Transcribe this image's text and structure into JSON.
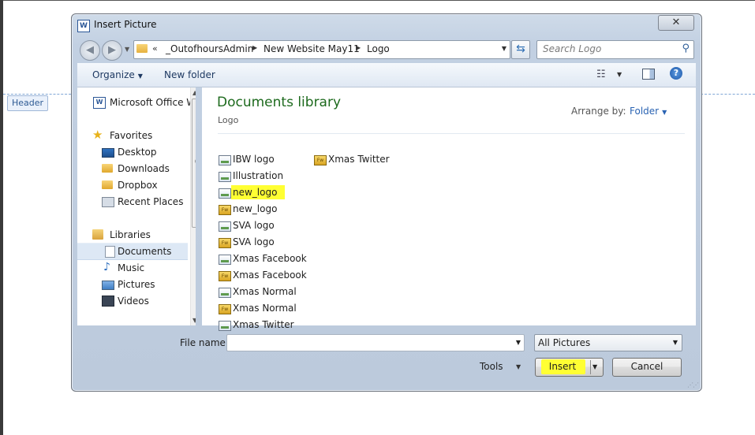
{
  "background": {
    "header_tag": "Header"
  },
  "dialog": {
    "title": "Insert Picture",
    "title_icon_glyph": "W",
    "close_glyph": "✕",
    "colors": {
      "library_title": "#1d6a1d",
      "link_blue": "#2a63b3",
      "highlight": "#ffff33"
    }
  },
  "address": {
    "overflow_glyph": "«",
    "crumbs": [
      "_OutofhoursAdmin",
      "New Website May11",
      "Logo"
    ]
  },
  "search": {
    "placeholder": "Search Logo"
  },
  "toolbar": {
    "organize_label": "Organize",
    "new_folder_label": "New folder"
  },
  "nav": {
    "computer_item": "Microsoft Office W",
    "favorites_header": "Favorites",
    "favorites": [
      "Desktop",
      "Downloads",
      "Dropbox",
      "Recent Places"
    ],
    "libraries_header": "Libraries",
    "libraries": [
      "Documents",
      "Music",
      "Pictures",
      "Videos"
    ],
    "selected": "Documents"
  },
  "content": {
    "library_title": "Documents library",
    "library_subtitle": "Logo",
    "arrange_label": "Arrange by:",
    "arrange_value": "Folder",
    "files": [
      {
        "name": "IBW logo",
        "icon": "image-file-icon",
        "highlighted": false
      },
      {
        "name": "Illustration",
        "icon": "image-file-icon",
        "highlighted": false
      },
      {
        "name": "new_logo",
        "icon": "image-file-icon",
        "highlighted": true
      },
      {
        "name": "new_logo",
        "icon": "fireworks-file-icon",
        "highlighted": false
      },
      {
        "name": "SVA logo",
        "icon": "image-file-icon",
        "highlighted": false
      },
      {
        "name": "SVA logo",
        "icon": "fireworks-file-icon",
        "highlighted": false
      },
      {
        "name": "Xmas Facebook",
        "icon": "image-file-icon",
        "highlighted": false
      },
      {
        "name": "Xmas Facebook",
        "icon": "fireworks-file-icon",
        "highlighted": false
      },
      {
        "name": "Xmas Normal",
        "icon": "image-file-icon",
        "highlighted": false
      },
      {
        "name": "Xmas Normal",
        "icon": "fireworks-file-icon",
        "highlighted": false
      },
      {
        "name": "Xmas Twitter",
        "icon": "image-file-icon",
        "highlighted": false
      },
      {
        "name": "Xmas Twitter",
        "icon": "fireworks-file-icon",
        "highlighted": false
      }
    ]
  },
  "footer": {
    "file_name_label": "File name:",
    "file_name_value": "",
    "filter_value": "All Pictures",
    "tools_label": "Tools",
    "insert_label": "Insert",
    "cancel_label": "Cancel"
  }
}
